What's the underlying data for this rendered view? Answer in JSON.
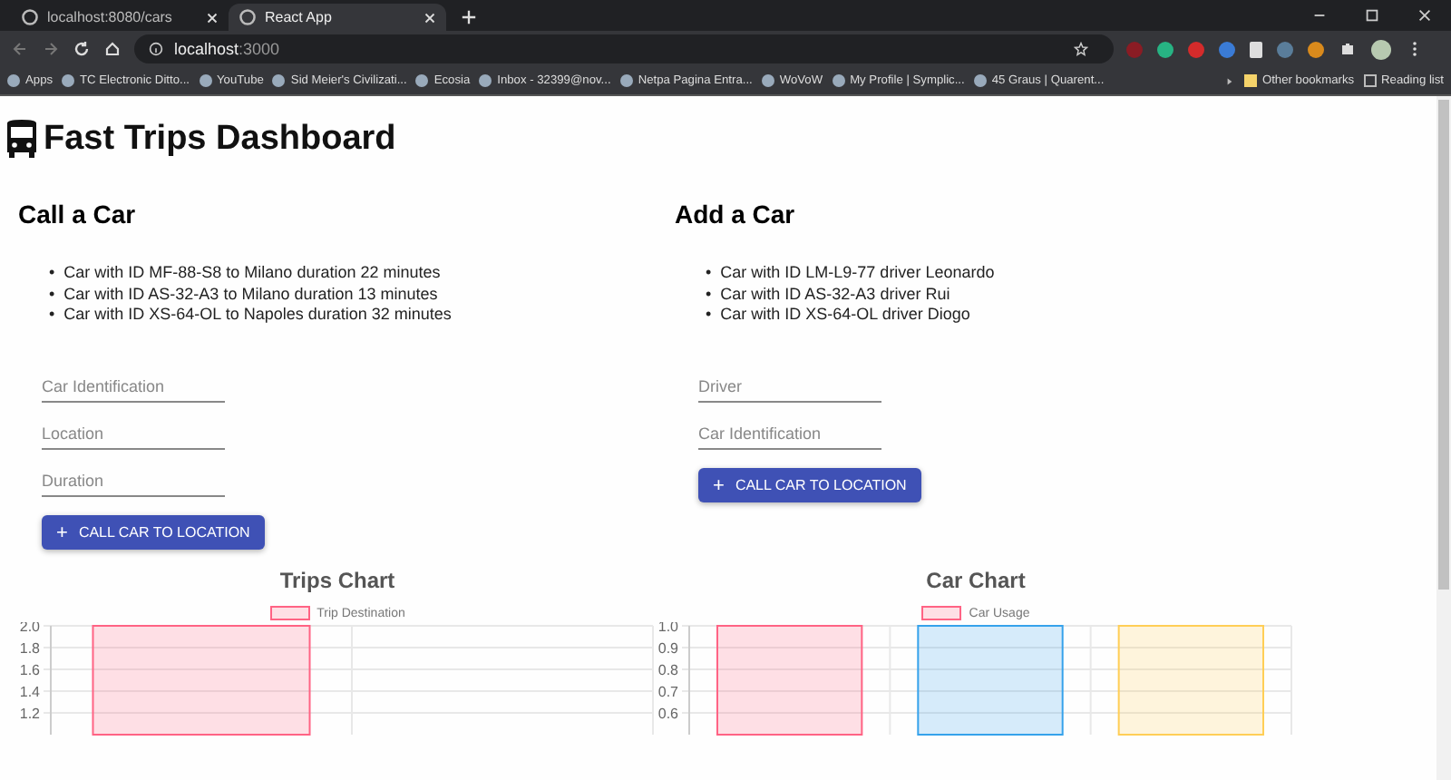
{
  "browser": {
    "tabs": [
      {
        "title": "localhost:8080/cars",
        "selected": false
      },
      {
        "title": "React App",
        "selected": true
      }
    ],
    "address": {
      "host": "localhost",
      "port": ":3000"
    },
    "bookmarks": [
      {
        "label": "Apps"
      },
      {
        "label": "TC Electronic Ditto..."
      },
      {
        "label": "YouTube"
      },
      {
        "label": "Sid Meier's Civilizati..."
      },
      {
        "label": "Ecosia"
      },
      {
        "label": "Inbox - 32399@nov..."
      },
      {
        "label": "Netpa Pagina Entra..."
      },
      {
        "label": "WoVoW"
      },
      {
        "label": "My Profile | Symplic..."
      },
      {
        "label": "45 Graus | Quarent..."
      }
    ],
    "other_bookmarks": "Other bookmarks",
    "reading_list": "Reading list"
  },
  "page": {
    "title": "Fast Trips Dashboard",
    "sections": [
      {
        "heading": "Call a Car",
        "marker": "•",
        "items": [
          "Car with ID MF-88-S8 to Milano duration 22 minutes",
          "Car with ID AS-32-A3 to Milano duration 13 minutes",
          "Car with ID XS-64-OL to Napoles duration 32 minutes"
        ],
        "fields": [
          {
            "placeholder": "Car Identification"
          },
          {
            "placeholder": "Location"
          },
          {
            "placeholder": "Duration"
          }
        ],
        "button": {
          "icon": "+",
          "label": "CALL CAR TO LOCATION"
        }
      },
      {
        "heading": "Add a Car",
        "marker": "•",
        "items": [
          "Car with ID LM-L9-77 driver Leonardo",
          "Car with ID AS-32-A3 driver Rui",
          "Car with ID XS-64-OL driver Diogo"
        ],
        "fields": [
          {
            "placeholder": "Driver"
          },
          {
            "placeholder": "Car Identification"
          }
        ],
        "button": {
          "icon": "+",
          "label": "CALL CAR TO LOCATION"
        }
      }
    ],
    "charts": [
      {
        "chart_data": {
          "type": "bar",
          "title": "Trips Chart",
          "series": [
            {
              "name": "Trip Destination",
              "color": "#ff6384",
              "values": [
                2,
                null
              ]
            }
          ],
          "grid": true,
          "ylim": [
            1,
            2
          ],
          "yticks": [
            {
              "value": 1.2,
              "label": "1.2"
            },
            {
              "value": 1.4,
              "label": "1.4"
            },
            {
              "value": 1.6,
              "label": "1.6"
            },
            {
              "value": 1.8,
              "label": "1.8"
            },
            {
              "value": 2,
              "label": "2.0"
            }
          ]
        }
      },
      {
        "chart_data": {
          "type": "bar",
          "title": "Car Chart",
          "series": [
            {
              "name": "Car Usage",
              "color": [
                "#ff6384",
                "#36a2eb",
                "#ffce56"
              ],
              "values": [
                1,
                1,
                1
              ]
            }
          ],
          "grid": true,
          "ylim": [
            0.5,
            1
          ],
          "yticks": [
            {
              "value": 0.6,
              "label": "0.6"
            },
            {
              "value": 0.7,
              "label": "0.7"
            },
            {
              "value": 0.8,
              "label": "0.8"
            },
            {
              "value": 0.9,
              "label": "0.9"
            },
            {
              "value": 1,
              "label": "1.0"
            }
          ]
        }
      }
    ]
  }
}
